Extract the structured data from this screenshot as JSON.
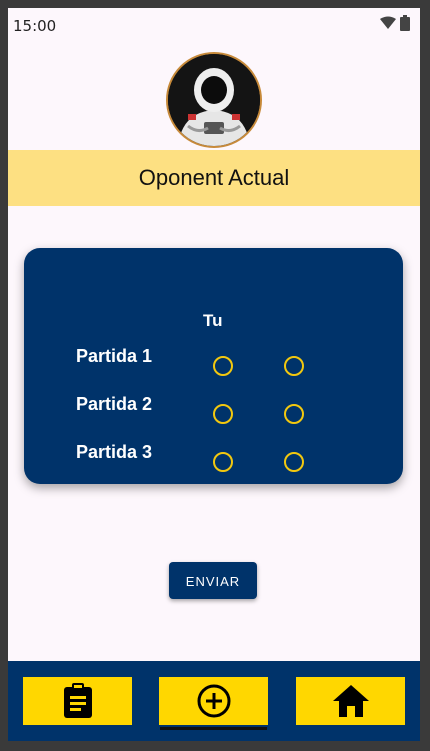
{
  "status_bar": {
    "time": "15:00",
    "icons": [
      "wifi-icon",
      "battery-icon"
    ]
  },
  "header": {
    "title": "Oponent Actual",
    "avatar_icon": "astronaut-avatar"
  },
  "card": {
    "column_header": "Tu",
    "rows": [
      {
        "label": "Partida 1"
      },
      {
        "label": "Partida 2"
      },
      {
        "label": "Partida 3"
      }
    ]
  },
  "actions": {
    "send_label": "ENVIAR"
  },
  "bottom_nav": {
    "items": [
      {
        "icon": "clipboard-icon"
      },
      {
        "icon": "add-circle-icon",
        "selected": true
      },
      {
        "icon": "home-icon"
      }
    ]
  },
  "colors": {
    "primary": "#00336a",
    "accent": "#ffd700",
    "band": "#fde082",
    "radio": "#f2c80f"
  }
}
